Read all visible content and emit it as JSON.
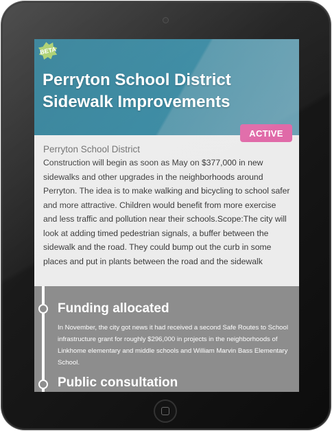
{
  "badge": {
    "beta": "BETA"
  },
  "project": {
    "title": "Perryton School District Sidewalk Improvements",
    "status": "ACTIVE",
    "district": "Perryton School District",
    "description": "Construction will begin as soon as May on $377,000 in new sidewalks and other upgrades in the neighborhoods around Perryton. The idea is to make walking and bicycling to school safer and more attractive. Children would benefit from more exercise and less traffic and pollution near their schools.Scope:The city will look at adding timed pedestrian signals, a buffer between the sidewalk and the road. They could bump out the curb in some places and put in plants between the road and the sidewalk"
  },
  "timeline": {
    "events": [
      {
        "title": "Funding allocated",
        "text": "In November, the city got news it had received a second Safe Routes to School infrastructure grant for roughly $296,000 in projects in the neighborhoods of Linkhome elementary and middle schools and William Marvin Bass Elementary School."
      },
      {
        "title": "Public consultation",
        "text": ""
      }
    ]
  },
  "colors": {
    "hero": "#2e7d95",
    "status_badge": "#e06aa8",
    "beta_badge": "#a9cf6b",
    "timeline_bg": "#8d8d8d"
  }
}
